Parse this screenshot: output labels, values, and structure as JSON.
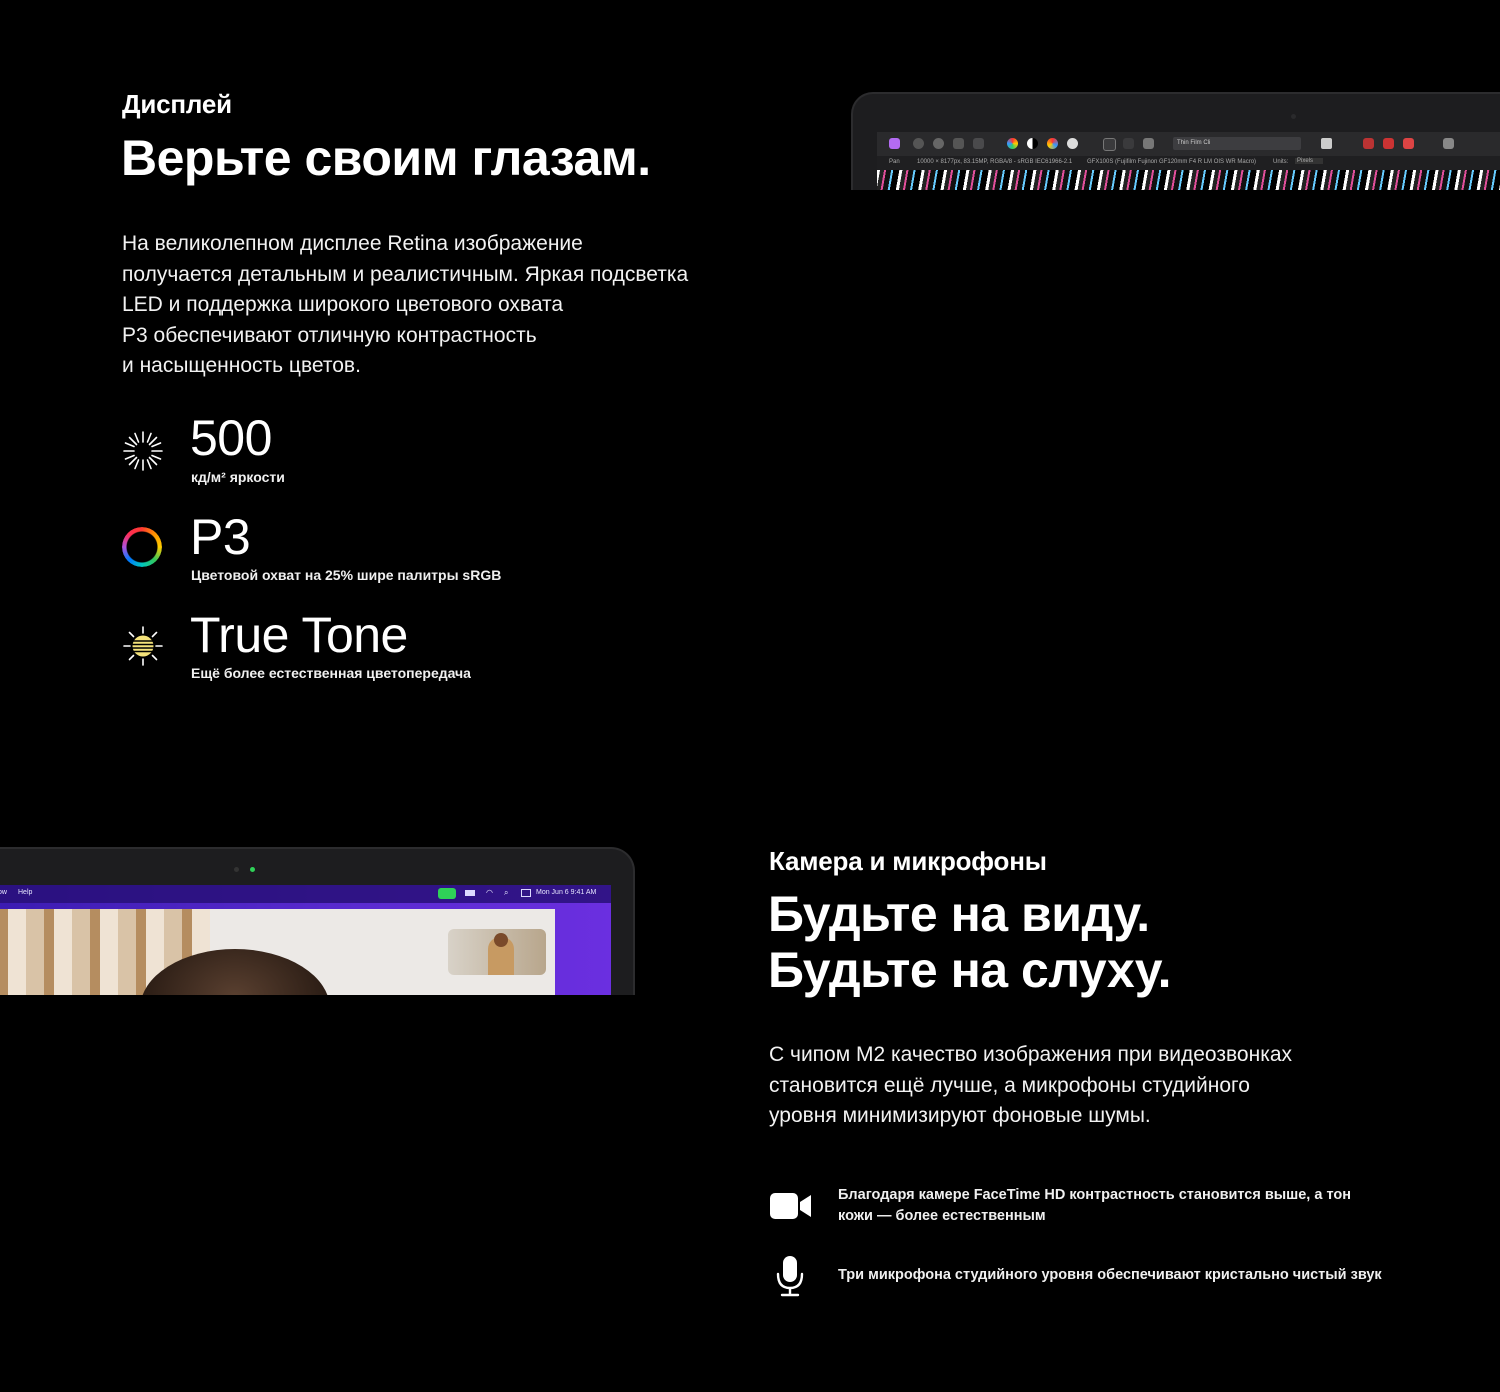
{
  "display_section": {
    "eyebrow": "Дисплей",
    "headline": "Верьте своим глазам.",
    "body_lines": [
      "На великолепном дисплее Retina изображение",
      "получается детальным и реалистичным. Яркая подсветка",
      "LED и поддержка широкого цветового охвата",
      "P3 обеспечивают отличную контрастность",
      "и насыщенность цветов."
    ],
    "stats": [
      {
        "value": "500",
        "caption": "кд/м² яркости",
        "icon": "brightness-icon"
      },
      {
        "value": "P3",
        "caption": "Цветовой охват на 25% шире палитры sRGB",
        "icon": "color-ring-icon"
      },
      {
        "value": "True Tone",
        "caption": "Ещё более естественная цветопередача",
        "icon": "true-tone-icon"
      }
    ],
    "laptop_screen": {
      "search_text": "Thin Film Cli",
      "status_left": "Pan",
      "status_info": "10000 × 8177px, 83.15MP, RGBA/8 - sRGB IEC61966-2.1",
      "status_lens": "GFX100S (Fujifilm Fujinon GF120mm F4 R LM OIS WR Macro)",
      "units_label": "Units:",
      "units_value": "Pixels"
    }
  },
  "camera_section": {
    "eyebrow": "Камера и микрофоны",
    "headline_lines": [
      "Будьте на виду.",
      "Будьте на слуху."
    ],
    "body_lines": [
      "С чипом M2 качество изображения при видеозвонках",
      "становится ещё лучше, а микрофоны студийного",
      "уровня минимизируют фоновые шумы."
    ],
    "features": [
      {
        "icon": "video-camera-icon",
        "lines": [
          "Благодаря камере FaceTime HD контрастность становится выше, а тон",
          "кожи — более естественным"
        ]
      },
      {
        "icon": "microphone-icon",
        "lines": [
          "Три микрофона студийного уровня обеспечивают кристально чистый звук"
        ]
      }
    ],
    "laptop_screen": {
      "menu_left": "ow",
      "menu_help": "Help",
      "menu_clock": "Mon Jun 6  9:41 AM"
    }
  },
  "colors": {
    "background": "#000000",
    "text": "#ffffff",
    "true_tone_yellow": "#f4e27a",
    "camera_active_green": "#2fd158"
  }
}
